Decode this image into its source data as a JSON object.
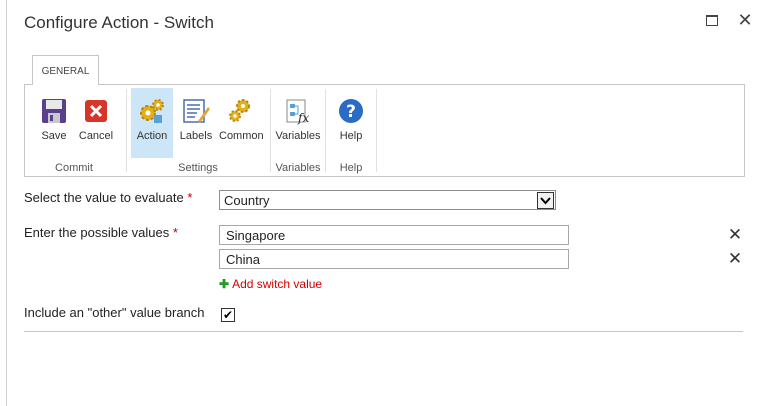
{
  "dialog": {
    "title": "Configure Action - Switch"
  },
  "window_controls": {
    "maximize_icon": "maximize-icon",
    "close_icon": "close-icon",
    "close_glyph": "✕"
  },
  "ribbon": {
    "tab": "GENERAL",
    "groups": [
      {
        "label": "Commit",
        "buttons": [
          {
            "label": "Save",
            "icon": "save-icon"
          },
          {
            "label": "Cancel",
            "icon": "cancel-icon"
          }
        ]
      },
      {
        "label": "Settings",
        "buttons": [
          {
            "label": "Action",
            "icon": "gears-icon",
            "active": true
          },
          {
            "label": "Labels",
            "icon": "labels-icon"
          },
          {
            "label": "Common",
            "icon": "common-gears-icon"
          }
        ]
      },
      {
        "label": "Variables",
        "buttons": [
          {
            "label": "Variables",
            "icon": "variables-fx-icon"
          }
        ]
      },
      {
        "label": "Help",
        "buttons": [
          {
            "label": "Help",
            "icon": "help-icon"
          }
        ]
      }
    ]
  },
  "form": {
    "evaluate_label": "Select the value to evaluate",
    "required_mark": "*",
    "evaluate_value": "Country",
    "possible_label": "Enter the possible values",
    "values": [
      "Singapore",
      "China"
    ],
    "delete_glyph": "✕",
    "add_link": "Add switch value",
    "add_plus": "✚",
    "other_label": "Include an \"other\" value branch",
    "other_checked": true,
    "check_glyph": "✔"
  },
  "colors": {
    "required": "#c00000",
    "link": "#d40000",
    "active_button": "#cde6f7"
  }
}
